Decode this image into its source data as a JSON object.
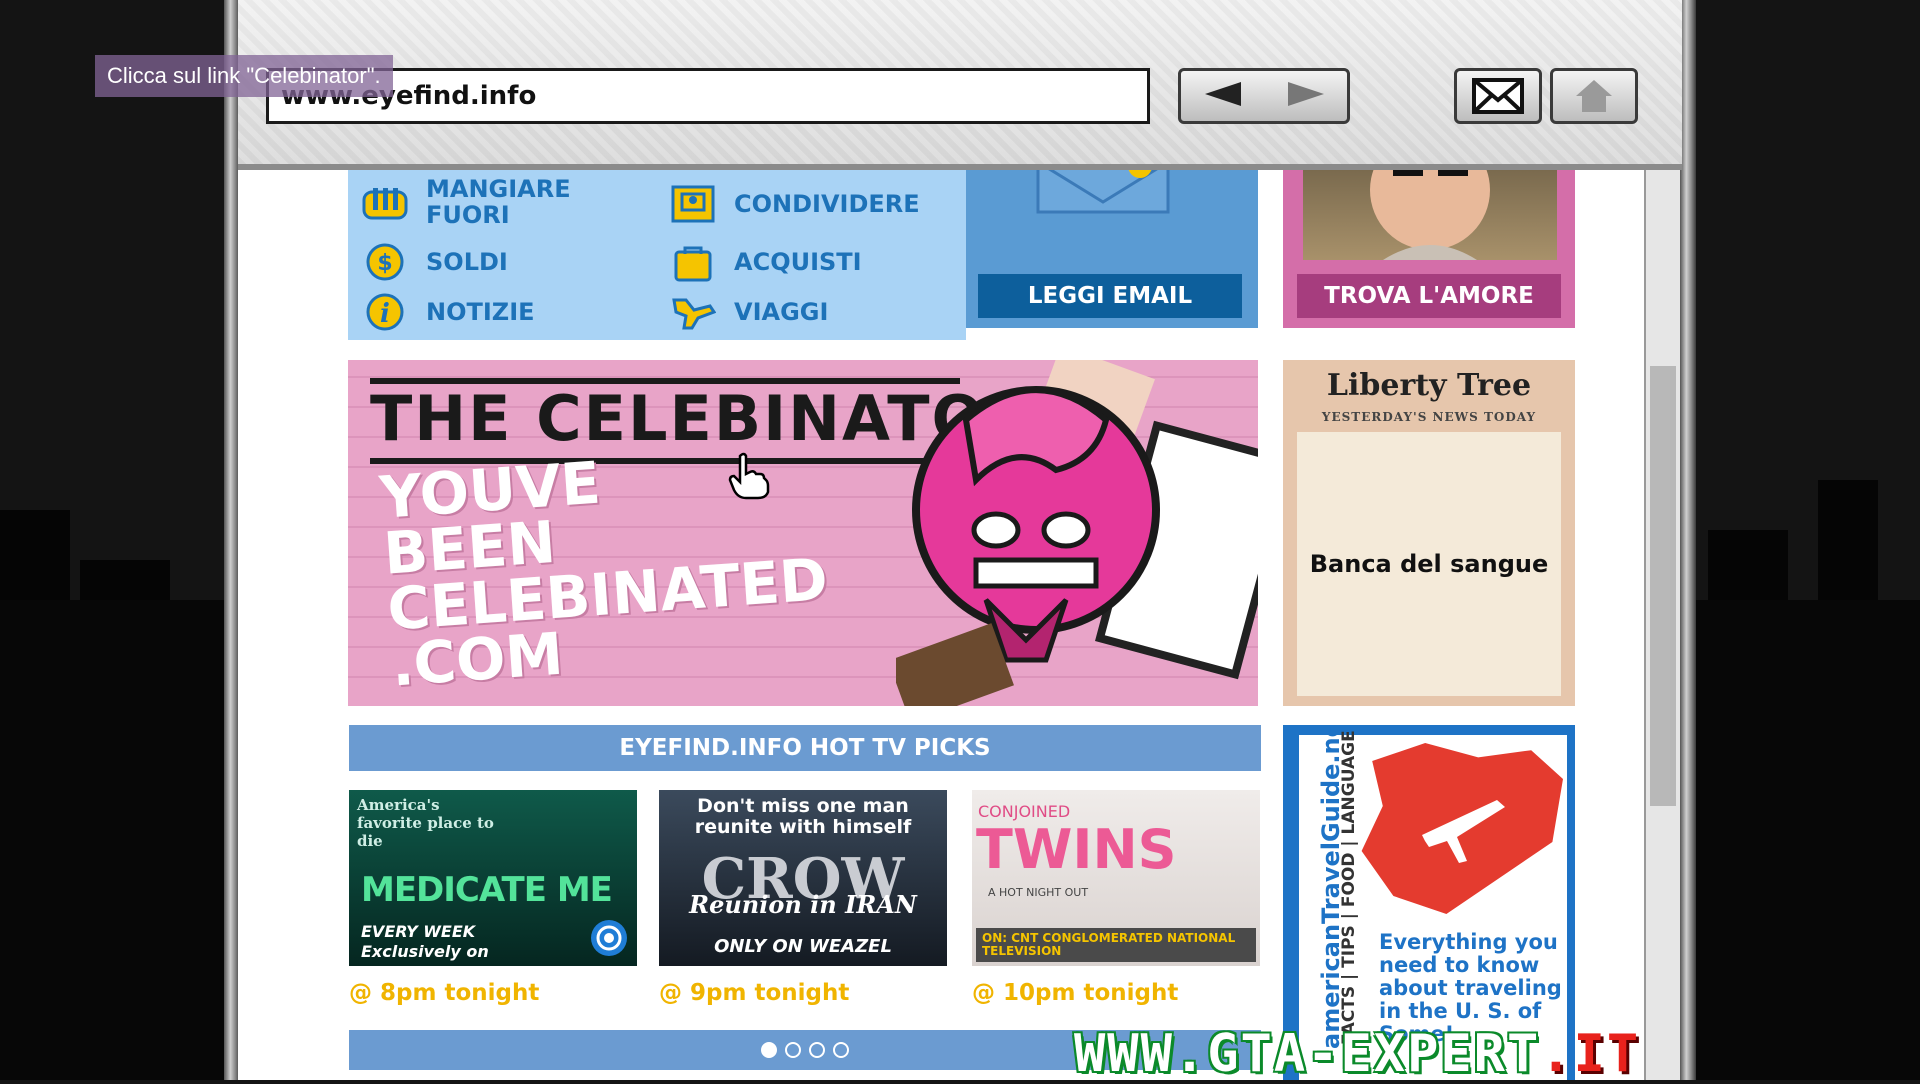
{
  "hint": "Clicca sul link \"Celebinator\".",
  "browser": {
    "url": "www.eyefind.info",
    "back_label": "Back",
    "forward_label": "Forward"
  },
  "categories": [
    {
      "label": "MANGIARE FUORI",
      "icon": "fork-knife-icon"
    },
    {
      "label": "CONDIVIDERE",
      "icon": "share-frame-icon"
    },
    {
      "label": "SOLDI",
      "icon": "dollar-icon"
    },
    {
      "label": "ACQUISTI",
      "icon": "shopping-bag-icon"
    },
    {
      "label": "NOTIZIE",
      "icon": "info-icon"
    },
    {
      "label": "VIAGGI",
      "icon": "airplane-icon"
    }
  ],
  "email": {
    "button": "LEGGI EMAIL"
  },
  "love": {
    "button": "TROVA L'AMORE"
  },
  "banner": {
    "title": "THE CELEBINATOR",
    "subtitle_lines": [
      "YOUVE",
      "BEEN",
      "CELEBINATED",
      ".COM"
    ]
  },
  "liberty": {
    "logo": "Liberty Tree",
    "tagline": "YESTERDAY'S NEWS TODAY",
    "content": "Banca del sangue"
  },
  "tv": {
    "header": "EYEFIND.INFO HOT TV PICKS",
    "cards": [
      {
        "top": "America's favorite place to die",
        "title": "MEDICATE ME",
        "footer": "EVERY WEEK Exclusively on",
        "time": "@ 8pm tonight"
      },
      {
        "top": "Don't miss one man reunite with himself",
        "title": "CROW",
        "subtitle": "Reunion in IRAN",
        "footer": "ONLY ON WEAZEL",
        "time": "@ 9pm tonight"
      },
      {
        "top": "CONJOINED",
        "title": "TWINS",
        "subtitle": "A HOT NIGHT OUT",
        "footer": "ON: CNT CONGLOMERATED NATIONAL TELEVISION",
        "time": "@ 10pm tonight"
      }
    ],
    "dots": 4,
    "active_dot": 0
  },
  "travel": {
    "site": "americanTravelGuide.net",
    "topics": "FACTS | TIPS | FOOD | LANGUAGE",
    "text": "Everything you need to know about traveling in the U. S. of Some!"
  },
  "watermark": {
    "main": "WWW.GTA-EXPERT",
    "tld": ".IT"
  }
}
